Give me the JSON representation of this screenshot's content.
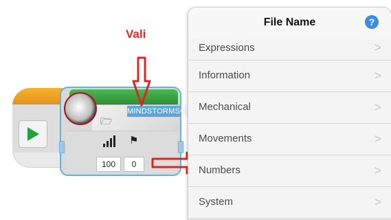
{
  "annotation": {
    "label": "Vali",
    "color": "#e02424"
  },
  "start_block": {
    "play_icon": "play-icon",
    "accent_color": "#22a23a"
  },
  "sound_block": {
    "brand_label": "MINDSTORMS",
    "speaker_icon": "speaker-icon",
    "folder_icon": "folder-icon",
    "volume_icon": "volume-bars-icon",
    "wait_icon": "checkered-flag-icon",
    "volume_value": "100",
    "wait_value": "0",
    "header_color": "#3a9e40",
    "tag_color": "#5aa7d8"
  },
  "popover": {
    "title": "File Name",
    "help_label": "?",
    "chevron": ">",
    "items": [
      {
        "label": "Expressions"
      },
      {
        "label": "Information"
      },
      {
        "label": "Mechanical"
      },
      {
        "label": "Movements"
      },
      {
        "label": "Numbers"
      },
      {
        "label": "System"
      }
    ]
  }
}
